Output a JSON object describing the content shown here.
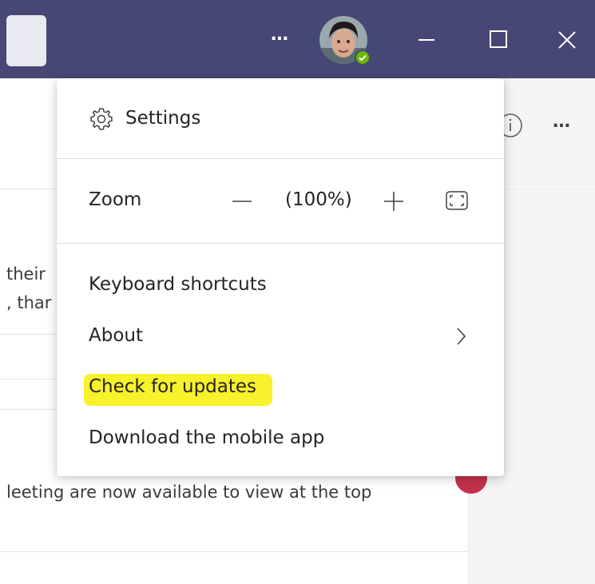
{
  "titlebar": {
    "more_label": "…",
    "icons": [
      "more-icon",
      "avatar",
      "minimize-icon",
      "maximize-icon",
      "close-icon"
    ],
    "color": "#464775",
    "presence_color": "#6bb700"
  },
  "background": {
    "line1": "their",
    "line2": ", thar",
    "line3": "leeting are now available to view at the top",
    "more_label": "…"
  },
  "menu": {
    "settings_label": "Settings",
    "zoom_label": "Zoom",
    "zoom_value": "(100%)",
    "keyboard_label": "Keyboard shortcuts",
    "about_label": "About",
    "updates_label": "Check for updates",
    "mobile_label": "Download the mobile app",
    "highlight_color": "#f7f22b"
  }
}
